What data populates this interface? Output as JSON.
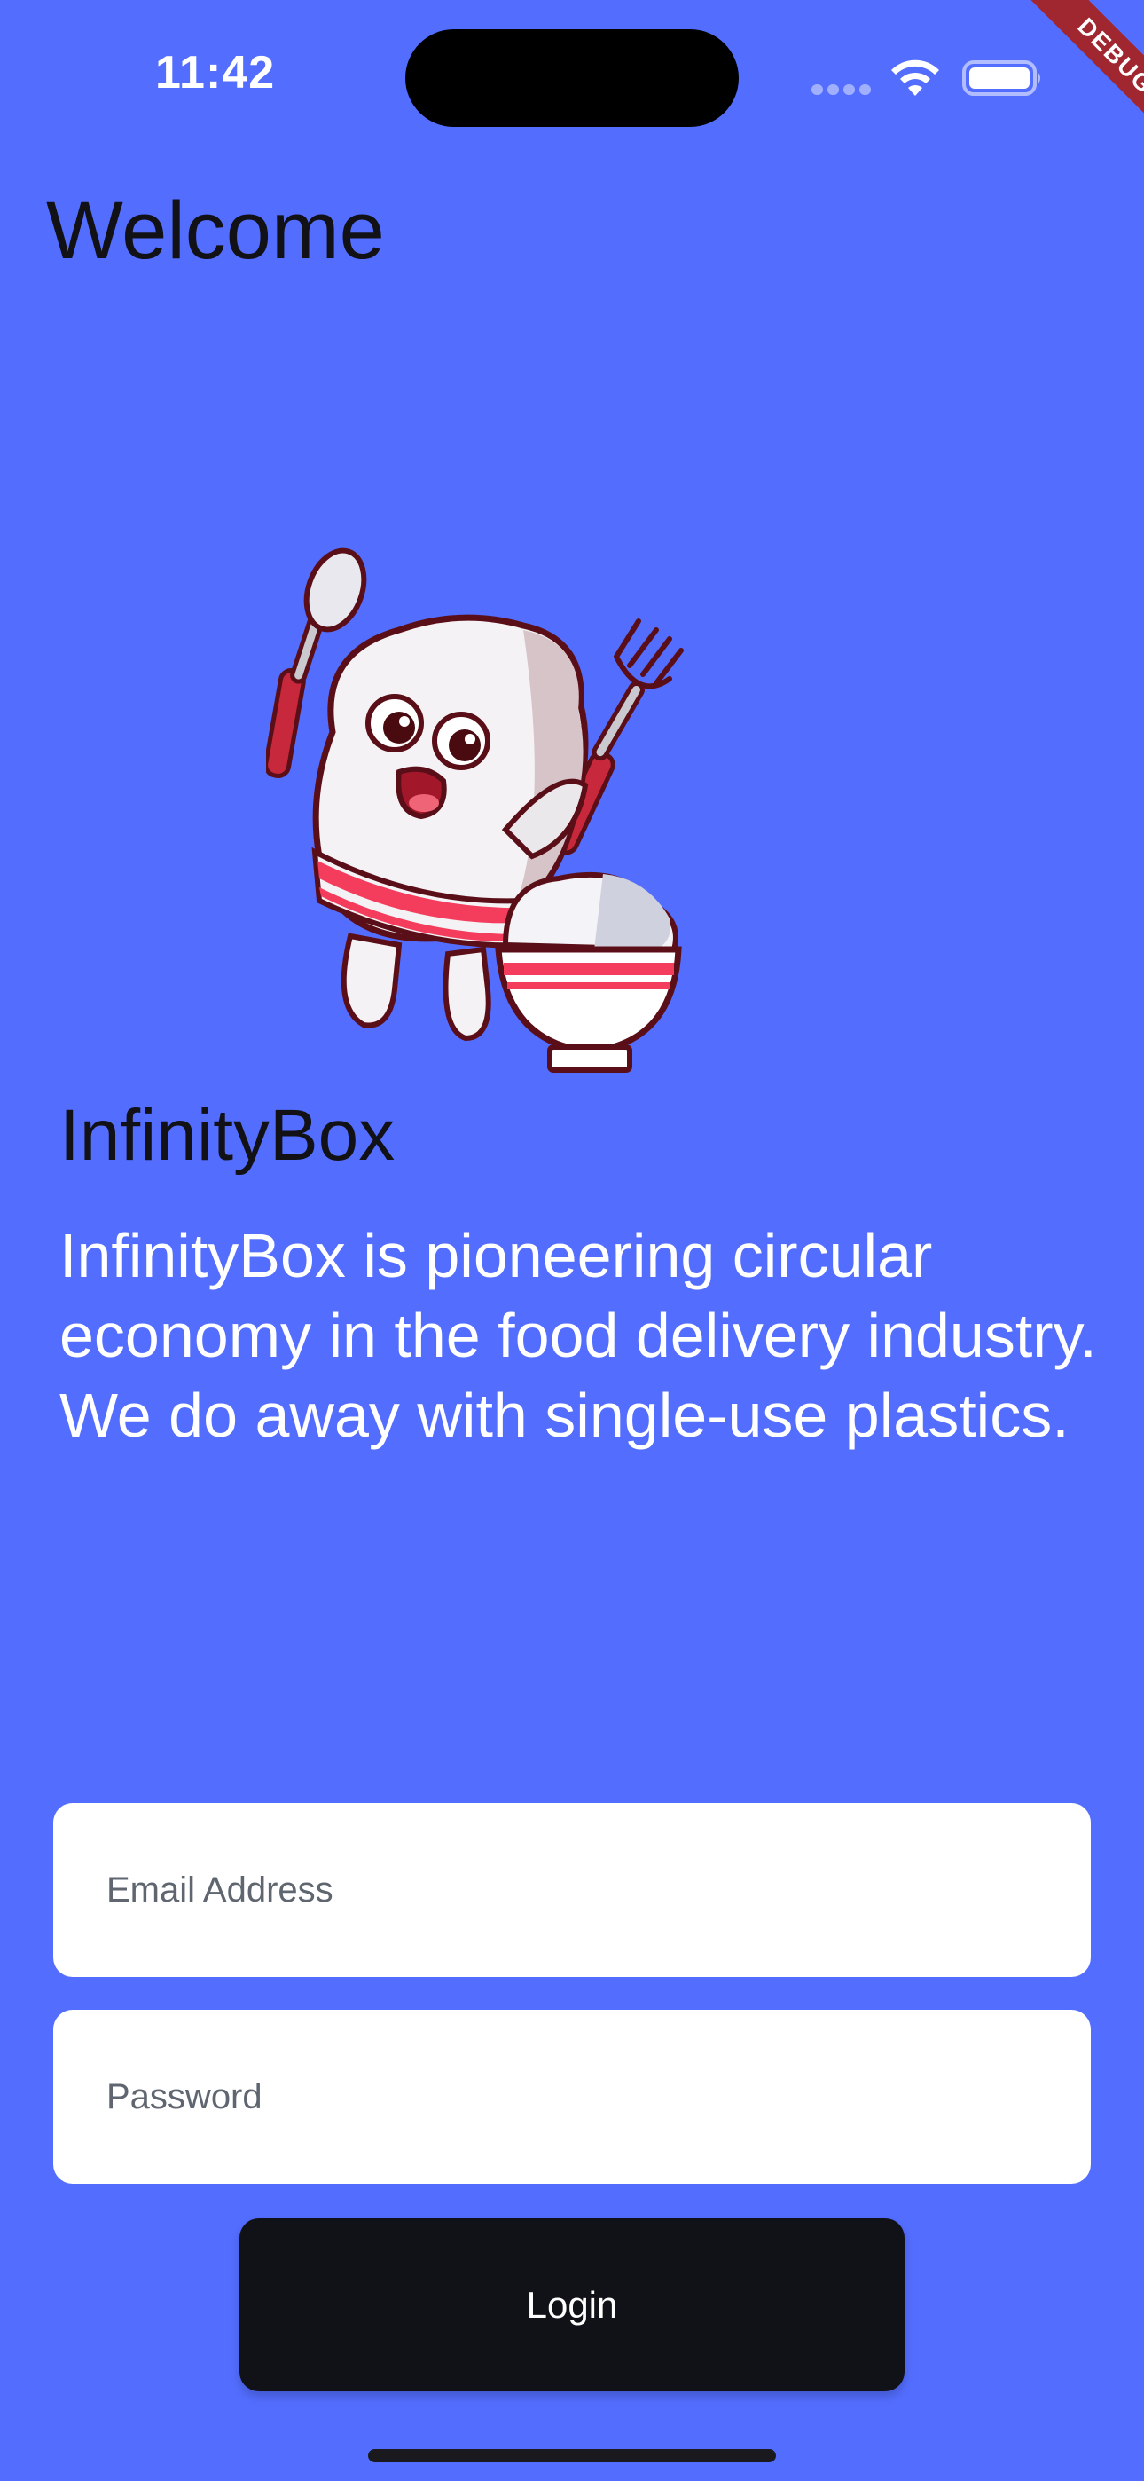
{
  "status_bar": {
    "time": "11:42"
  },
  "debug_banner": "DEBUG",
  "page": {
    "title": "Welcome"
  },
  "brand": {
    "name": "InfinityBox",
    "description": "InfinityBox is pioneering circular economy in the food delivery industry. We do away with single-use plastics."
  },
  "form": {
    "email_placeholder": "Email Address",
    "email_value": "",
    "password_placeholder": "Password",
    "password_value": "",
    "login_label": "Login"
  },
  "colors": {
    "background": "#536dfe",
    "button": "#111217",
    "field": "#ffffff",
    "debug_ribbon": "#a0262f"
  },
  "icons": {
    "wifi": "wifi-icon",
    "battery": "battery-icon",
    "signal": "signal-dots-icon",
    "mascot": "rice-mascot-illustration"
  }
}
